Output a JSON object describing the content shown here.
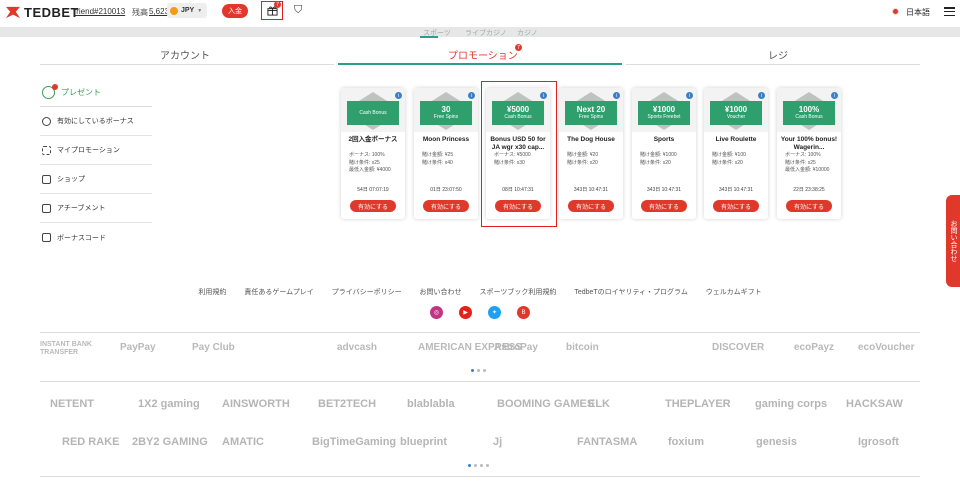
{
  "header": {
    "logo": "TEDBET",
    "username": "friend#210013",
    "balance_label": "残高",
    "balance": "5,623",
    "currency": "JPY",
    "deposit_label": "入金",
    "gift_badge": "7",
    "language": "日本語"
  },
  "subnav": [
    "スポーツ",
    "ライブカジノ",
    "カジノ"
  ],
  "tabs": {
    "account": "アカウント",
    "promotion": "プロモーション",
    "promotion_badge": "7",
    "lobby": "レジ"
  },
  "sidebar": [
    "プレゼント",
    "有効にしているボーナス",
    "マイプロモーション",
    "ショップ",
    "アチーブメント",
    "ボーナスコード"
  ],
  "cards": [
    {
      "value": "",
      "type": "Cash Bonus",
      "title": "2回入金ボーナス",
      "details": [
        "ボーナス: 100%",
        "賭け条件: x25",
        "最低入金額: ¥4000"
      ],
      "time": "54日 07:07:19",
      "button": "有効にする"
    },
    {
      "value": "30",
      "type": "Free Spins",
      "title": "Moon Princess",
      "details": [
        "賭け金額: ¥25",
        "賭け条件: x40"
      ],
      "time": "01日 23:07:50",
      "button": "有効にする"
    },
    {
      "value": "¥5000",
      "type": "Cash Bonus",
      "title": "Bonus USD 50 for JA wgr x30 cap...",
      "details": [
        "ボーナス: ¥5000",
        "賭け条件: x30"
      ],
      "time": "08日 10:47:31",
      "button": "有効にする"
    },
    {
      "value": "Next 20",
      "type": "Free Spins",
      "title": "The Dog House",
      "details": [
        "賭け金額: ¥20",
        "賭け条件: x20"
      ],
      "time": "343日 10:47:31",
      "button": "有効にする"
    },
    {
      "value": "¥1000",
      "type": "Sports Freebet",
      "title": "Sports",
      "details": [
        "賭け金額: ¥1000",
        "賭け条件: x20"
      ],
      "time": "343日 10:47:31",
      "button": "有効にする"
    },
    {
      "value": "¥1000",
      "type": "Voucher",
      "title": "Live Roulette",
      "details": [
        "賭け金額: ¥100",
        "賭け条件: x20"
      ],
      "time": "343日 10:47:31",
      "button": "有効にする"
    },
    {
      "value": "100%",
      "type": "Cash Bonus",
      "title": "Your 100% bonus! Wagerin...",
      "details": [
        "ボーナス: 100%",
        "賭け条件: x25",
        "最低入金額: ¥10000"
      ],
      "time": "22日 23:38:25",
      "button": "有効にする"
    }
  ],
  "contact": "お問い合わせ",
  "footer_links": [
    "利用規約",
    "責任あるゲームプレイ",
    "プライバシーポリシー",
    "お問い合わせ",
    "スポーツブック利用規約",
    "TedbeTのロイヤリティ・プログラム",
    "ウェルカムギフト"
  ],
  "payments": [
    "INSTANT BANK TRANSFER",
    "PayPay",
    "Pay Club",
    "advcash",
    "AMERICAN EXPRESS",
    "AstroPay",
    "bitcoin",
    "DISCOVER",
    "ecoPayz",
    "ecoVoucher"
  ],
  "providers_row1": [
    "NETENT",
    "1X2 gaming",
    "AINSWORTH",
    "BET2TECH",
    "blablabla",
    "BOOMING GAMES",
    "ELK",
    "THEPLAYER",
    "gaming corps",
    "HACKSAW"
  ],
  "providers_row2": [
    "RED RAKE",
    "2BY2 GAMING",
    "AMATIC",
    "BigTimeGaming",
    "blueprint",
    "Jj",
    "FANTASMA",
    "foxium",
    "genesis",
    "Igrosoft"
  ],
  "colors": {
    "accent": "#e0382b",
    "green": "#2f9f6e",
    "teal": "#2a9d8f"
  }
}
